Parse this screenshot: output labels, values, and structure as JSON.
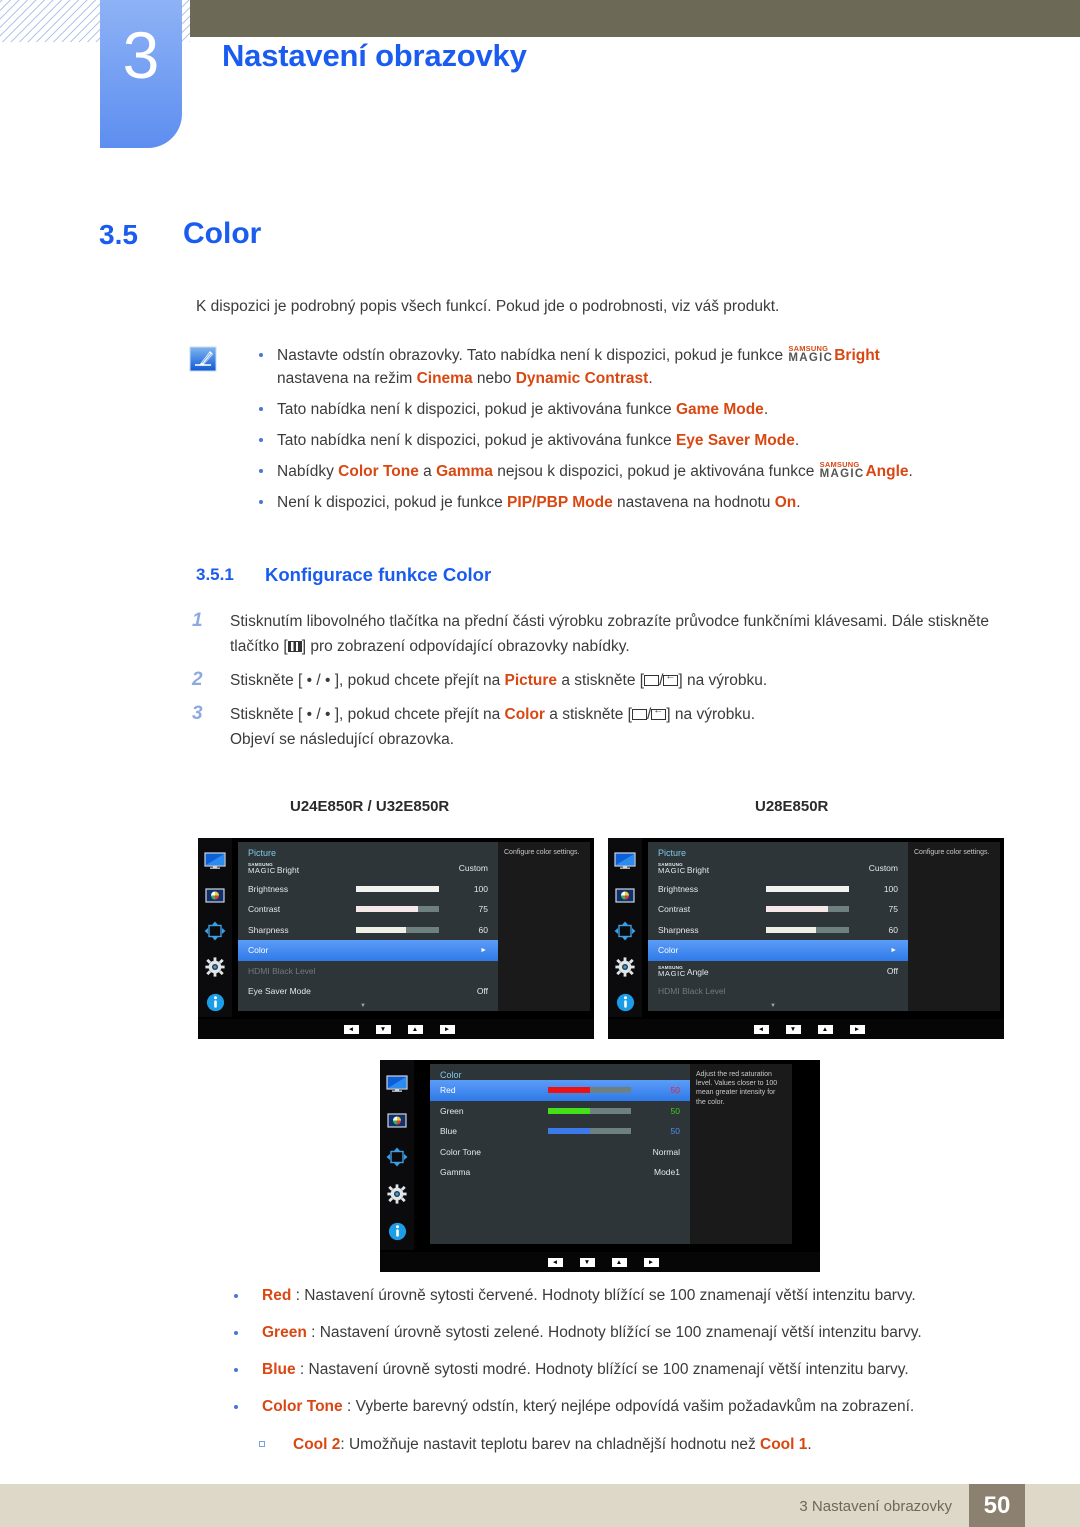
{
  "header": {
    "chapter_number": "3",
    "chapter_title": "Nastavení obrazovky"
  },
  "section": {
    "number": "3.5",
    "title": "Color"
  },
  "intro": "K dispozici je podrobný popis všech funkcí. Pokud jde o podrobnosti, viz váš produkt.",
  "notes": [
    {
      "text_1": "Nastavte odstín obrazovky. Tato nabídka není k dispozici, pokud je funkce ",
      "magic_top": "SAMSUNG",
      "magic_bottom": "MAGIC",
      "magic_word": "Bright",
      "text_2": "nastavena na režim ",
      "hl_1": "Cinema",
      "text_3": " nebo ",
      "hl_2": "Dynamic Contrast",
      "text_4": "."
    },
    {
      "text_1": "Tato nabídka není k dispozici, pokud je aktivována funkce ",
      "hl_1": "Game Mode",
      "text_2": "."
    },
    {
      "text_1": "Tato nabídka není k dispozici, pokud je aktivována funkce ",
      "hl_1": "Eye Saver Mode",
      "text_2": "."
    },
    {
      "text_1": "Nabídky ",
      "hl_1": "Color Tone",
      "text_2": " a ",
      "hl_2": "Gamma",
      "text_3": " nejsou k dispozici, pokud je aktivována funkce ",
      "magic_top": "SAMSUNG",
      "magic_bottom": "MAGIC",
      "magic_word": "Angle",
      "text_4": "."
    },
    {
      "text_1": "Není k dispozici, pokud je funkce ",
      "hl_1": "PIP/PBP Mode",
      "text_2": " nastavena na hodnotu ",
      "hl_2": "On",
      "text_3": "."
    }
  ],
  "subsection": {
    "number": "3.5.1",
    "title": "Konfigurace funkce Color"
  },
  "steps": [
    {
      "num": "1",
      "text_1": "Stisknutím libovolného tlačítka na přední části výrobku zobrazíte průvodce funkčními klávesami. Dále stiskněte tlačítko [",
      "text_2": "] pro zobrazení odpovídající obrazovky nabídky."
    },
    {
      "num": "2",
      "text_1": "Stiskněte [ • / • ], pokud chcete přejít na ",
      "hl_1": "Picture",
      "text_2": " a stiskněte [",
      "text_3": "] na výrobku."
    },
    {
      "num": "3",
      "text_1": "Stiskněte [ • / • ], pokud chcete přejít na ",
      "hl_1": "Color",
      "text_2": " a stiskněte [",
      "text_3": "] na výrobku.",
      "text_4": "Objeví se následující obrazovka."
    }
  ],
  "osd_captions": {
    "left": "U24E850R / U32E850R",
    "right": "U28E850R"
  },
  "osd_left": {
    "title": "Picture",
    "help": "Configure color settings.",
    "rows": [
      {
        "magic_top": "SAMSUNG",
        "magic_bottom": "MAGIC",
        "label": "Bright",
        "value": "Custom"
      },
      {
        "label": "Brightness",
        "value": "100",
        "bar": 100,
        "fill_color": "#f2f2ee"
      },
      {
        "label": "Contrast",
        "value": "75",
        "bar": 75,
        "fill_color": "#f6e9e9"
      },
      {
        "label": "Sharpness",
        "value": "60",
        "bar": 60,
        "fill_color": "#f1f0e4"
      },
      {
        "label": "Color",
        "value": "",
        "selected": true,
        "arrow": "►"
      },
      {
        "label": "HDMI Black Level",
        "value": "",
        "dim": true
      },
      {
        "label": "Eye Saver Mode",
        "value": "Off"
      }
    ],
    "nav": [
      "◄",
      "▼",
      "▲",
      "►"
    ]
  },
  "osd_right": {
    "title": "Picture",
    "help": "Configure color settings.",
    "rows": [
      {
        "magic_top": "SAMSUNG",
        "magic_bottom": "MAGIC",
        "label": "Bright",
        "value": "Custom"
      },
      {
        "label": "Brightness",
        "value": "100",
        "bar": 100,
        "fill_color": "#f2f2ee"
      },
      {
        "label": "Contrast",
        "value": "75",
        "bar": 75,
        "fill_color": "#f6e9e9"
      },
      {
        "label": "Sharpness",
        "value": "60",
        "bar": 60,
        "fill_color": "#f1f0e4"
      },
      {
        "label": "Color",
        "value": "",
        "selected": true,
        "arrow": "►"
      },
      {
        "magic_top": "SAMSUNG",
        "magic_bottom": "MAGIC",
        "label": "Angle",
        "value": "Off"
      },
      {
        "label": "HDMI Black Level",
        "value": "",
        "dim": true
      }
    ],
    "nav": [
      "◄",
      "▼",
      "▲",
      "►"
    ]
  },
  "osd_color": {
    "title": "Color",
    "help": "Adjust the red saturation level. Values closer to 100 mean greater intensity for the color.",
    "rows": [
      {
        "label": "Red",
        "value": "50",
        "bar": 50,
        "fill_color": "#ee1111",
        "value_color": "#ee2222",
        "selected": true
      },
      {
        "label": "Green",
        "value": "50",
        "bar": 50,
        "fill_color": "#44e01a",
        "value_color": "#3ece18"
      },
      {
        "label": "Blue",
        "value": "50",
        "bar": 50,
        "fill_color": "#3b7ae8",
        "value_color": "#4d8ef2"
      },
      {
        "label": "Color Tone",
        "value": "Normal"
      },
      {
        "label": "Gamma",
        "value": "Mode1"
      }
    ],
    "nav": [
      "◄",
      "▼",
      "▲",
      "►"
    ]
  },
  "bottom_list": [
    {
      "hl": "Red",
      "text": " : Nastavení úrovně sytosti červené. Hodnoty blížící se 100 znamenají větší intenzitu barvy."
    },
    {
      "hl": "Green",
      "text": " : Nastavení úrovně sytosti zelené. Hodnoty blížící se 100 znamenají větší intenzitu barvy."
    },
    {
      "hl": "Blue",
      "text": " : Nastavení úrovně sytosti modré. Hodnoty blížící se 100 znamenají větší intenzitu barvy."
    },
    {
      "hl": "Color Tone",
      "text": " : Vyberte barevný odstín, který nejlépe odpovídá vašim požadavkům na zobrazení."
    }
  ],
  "bottom_sub": {
    "hl_1": "Cool 2",
    "text_1": ": Umožňuje nastavit teplotu barev na chladnější hodnotu než ",
    "hl_2": "Cool 1",
    "text_2": "."
  },
  "footer": {
    "text": "3 Nastavení obrazovky",
    "page": "50"
  },
  "colors": {
    "accent_blue": "#1a5cf0",
    "highlight_orange": "#d94712",
    "header_brown": "#6c6a56",
    "footer_tan": "#ddd8c8"
  }
}
